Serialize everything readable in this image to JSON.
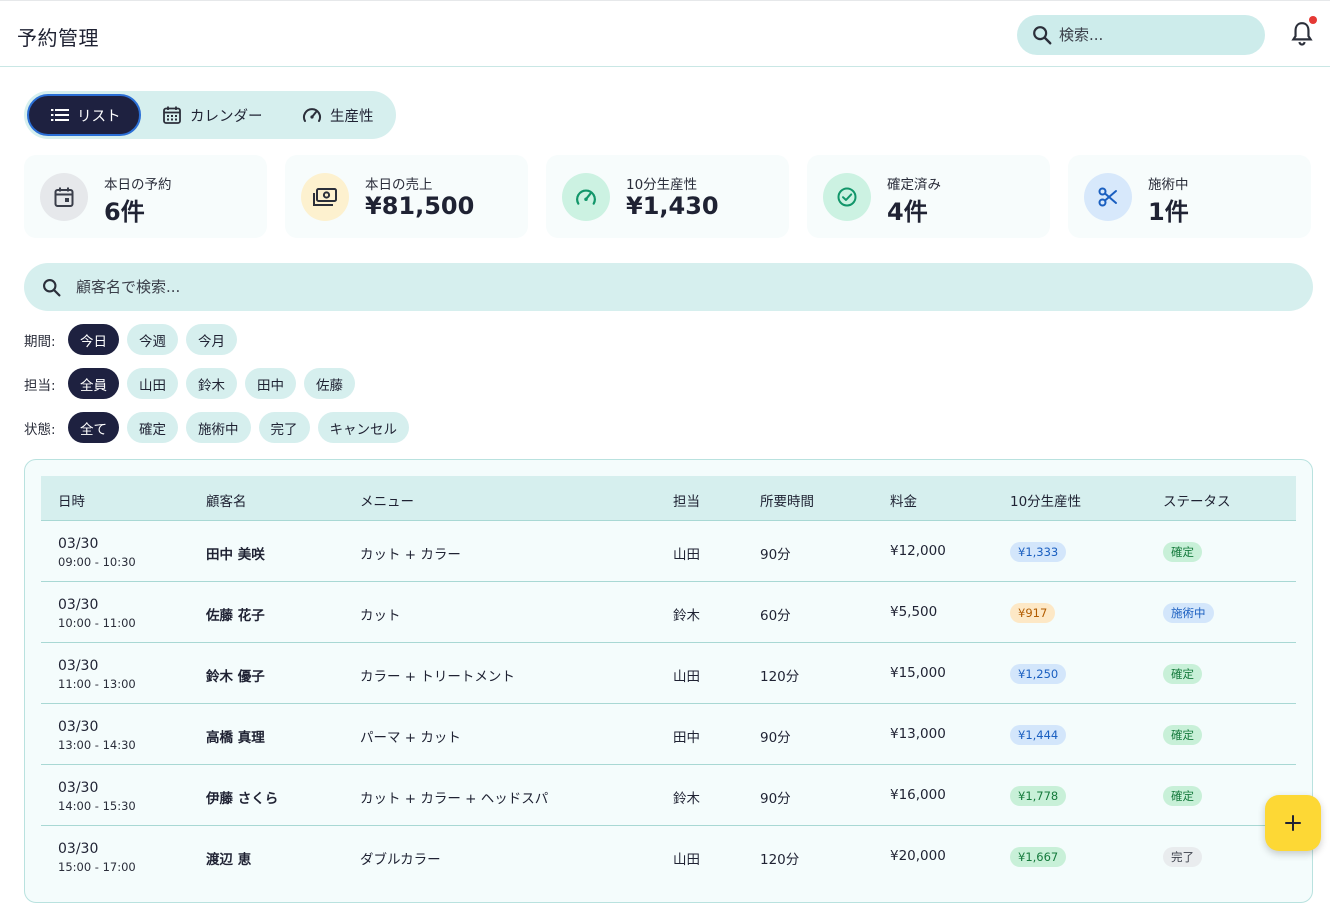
{
  "header": {
    "title": "予約管理",
    "search_placeholder": "検索..."
  },
  "view_tabs": [
    {
      "label": "リスト",
      "icon": "list-icon",
      "active": true
    },
    {
      "label": "カレンダー",
      "icon": "calendar-icon",
      "active": false
    },
    {
      "label": "生産性",
      "icon": "gauge-icon",
      "active": false
    }
  ],
  "stats": [
    {
      "label": "本日の予約",
      "value": "6件",
      "icon": "calendar-event-icon",
      "color": "#e6e8eb"
    },
    {
      "label": "本日の売上",
      "value": "¥81,500",
      "icon": "cash-icon",
      "color": "#fdf1cf"
    },
    {
      "label": "10分生産性",
      "value": "¥1,430",
      "icon": "gauge-icon",
      "color": "#ccf2e2"
    },
    {
      "label": "確定済み",
      "value": "4件",
      "icon": "check-circle-icon",
      "color": "#ccf2e2"
    },
    {
      "label": "施術中",
      "value": "1件",
      "icon": "scissors-icon",
      "color": "#d7e8fb"
    }
  ],
  "customer_search": {
    "placeholder": "顧客名で検索..."
  },
  "filters": {
    "period": {
      "label": "期間:",
      "options": [
        "今日",
        "今週",
        "今月"
      ],
      "active": 0
    },
    "staff": {
      "label": "担当:",
      "options": [
        "全員",
        "山田",
        "鈴木",
        "田中",
        "佐藤"
      ],
      "active": 0
    },
    "status": {
      "label": "状態:",
      "options": [
        "全て",
        "確定",
        "施術中",
        "完了",
        "キャンセル"
      ],
      "active": 0
    }
  },
  "table": {
    "columns": [
      "日時",
      "顧客名",
      "メニュー",
      "担当",
      "所要時間",
      "料金",
      "10分生産性",
      "ステータス"
    ],
    "rows": [
      {
        "date": "03/30",
        "time": "09:00 - 10:30",
        "customer": "田中 美咲",
        "menu": "カット + カラー",
        "staff": "山田",
        "duration": "90分",
        "price": "¥12,000",
        "productivity": "¥1,333",
        "prod_level": "blue",
        "status": "確定",
        "status_level": "green"
      },
      {
        "date": "03/30",
        "time": "10:00 - 11:00",
        "customer": "佐藤 花子",
        "menu": "カット",
        "staff": "鈴木",
        "duration": "60分",
        "price": "¥5,500",
        "productivity": "¥917",
        "prod_level": "amber",
        "status": "施術中",
        "status_level": "blue"
      },
      {
        "date": "03/30",
        "time": "11:00 - 13:00",
        "customer": "鈴木 優子",
        "menu": "カラー + トリートメント",
        "staff": "山田",
        "duration": "120分",
        "price": "¥15,000",
        "productivity": "¥1,250",
        "prod_level": "blue",
        "status": "確定",
        "status_level": "green"
      },
      {
        "date": "03/30",
        "time": "13:00 - 14:30",
        "customer": "高橋 真理",
        "menu": "パーマ + カット",
        "staff": "田中",
        "duration": "90分",
        "price": "¥13,000",
        "productivity": "¥1,444",
        "prod_level": "blue",
        "status": "確定",
        "status_level": "green"
      },
      {
        "date": "03/30",
        "time": "14:00 - 15:30",
        "customer": "伊藤 さくら",
        "menu": "カット + カラー + ヘッドスパ",
        "staff": "鈴木",
        "duration": "90分",
        "price": "¥16,000",
        "productivity": "¥1,778",
        "prod_level": "green",
        "status": "確定",
        "status_level": "green"
      },
      {
        "date": "03/30",
        "time": "15:00 - 17:00",
        "customer": "渡辺 恵",
        "menu": "ダブルカラー",
        "staff": "山田",
        "duration": "120分",
        "price": "¥20,000",
        "productivity": "¥1,667",
        "prod_level": "green",
        "status": "完了",
        "status_level": "gray"
      }
    ]
  },
  "fab": {
    "icon": "plus-icon"
  }
}
